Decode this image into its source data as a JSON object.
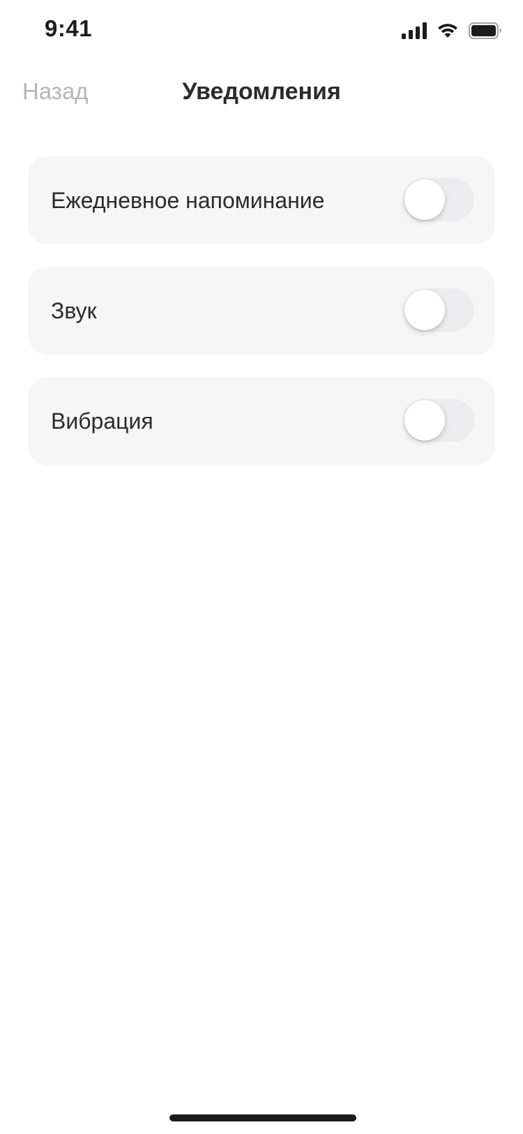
{
  "status_bar": {
    "time": "9:41",
    "icons": [
      "cellular-signal-icon",
      "wifi-icon",
      "battery-icon"
    ]
  },
  "nav": {
    "back_label": "Назад",
    "title": "Уведомления"
  },
  "settings": [
    {
      "label": "Ежедневное напоминание",
      "enabled": false
    },
    {
      "label": "Звук",
      "enabled": false
    },
    {
      "label": "Вибрация",
      "enabled": false
    }
  ],
  "colors": {
    "text_primary": "#2b2b2d",
    "text_muted": "#b5b5b8",
    "row_background": "#f6f6f7",
    "toggle_off": "#ececee"
  }
}
